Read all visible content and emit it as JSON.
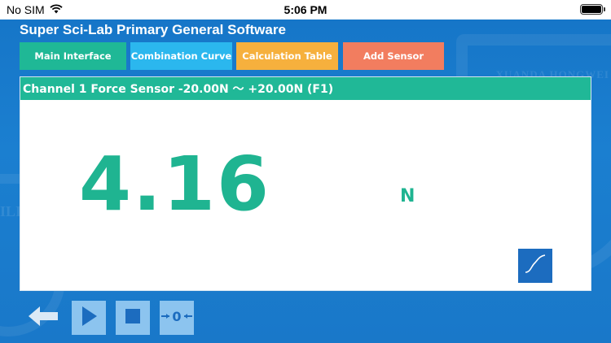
{
  "status_bar": {
    "carrier": "No SIM",
    "time": "5:06 PM",
    "icons": [
      "wifi-icon",
      "battery-icon"
    ]
  },
  "app": {
    "title": "Super Sci-Lab Primary General Software",
    "background_watermark_text": "XUANDA HONGWEI"
  },
  "nav": {
    "main_interface": "Main Interface",
    "combination_curve": "Combination Curve",
    "calculation_table": "Calculation Table",
    "add_sensor": "Add Sensor"
  },
  "channel": {
    "header": "Channel 1 Force Sensor -20.00N ～ +20.00N  (F1)",
    "value": "4.16",
    "unit": "N"
  },
  "controls": {
    "icons": [
      "back-arrow-icon",
      "play-icon",
      "stop-icon",
      "zero-calibrate-icon",
      "curve-chart-icon"
    ]
  },
  "colors": {
    "background_blue": "#1b7fd0",
    "teal": "#1fb896",
    "sky": "#2bb7ee",
    "orange": "#f6b03d",
    "coral": "#f27d5f",
    "control_light_blue": "#8cc4ef"
  }
}
